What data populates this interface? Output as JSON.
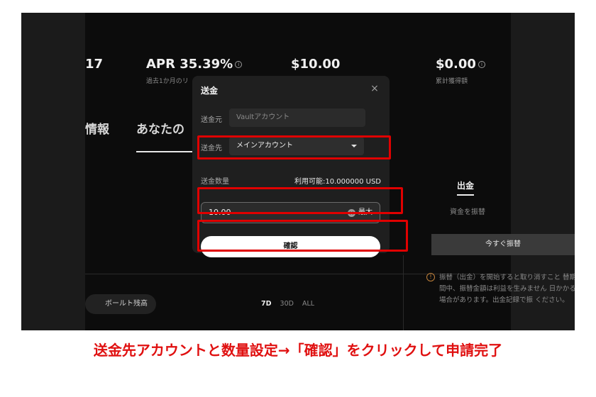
{
  "stats": [
    {
      "value": "17",
      "label": ""
    },
    {
      "value": "APR 35.39%",
      "label": "過去1か月のリ",
      "info": "i"
    },
    {
      "value": "$10.00",
      "label": ""
    },
    {
      "value": "$0.00",
      "label": "累計獲得額",
      "info": "i"
    }
  ],
  "tabs": {
    "info_partial": "情報",
    "yours_partial": "あなたの"
  },
  "right_panel": {
    "withdraw_tab": "出金",
    "sub_text": "資金を振替",
    "transfer_now": "今すぐ振替",
    "warning": "振替（出金）を開始すると取り消すこと 替期間中、振替金額は利益を生みません 日かかる場合があります。出金記録で振 ください。"
  },
  "bottom": {
    "vault_balance": "ボールト残高",
    "periods": [
      "7D",
      "30D",
      "ALL"
    ],
    "active_period": "7D"
  },
  "modal": {
    "title": "送金",
    "close": "×",
    "from_label": "送金元",
    "from_value": "Vaultアカウント",
    "to_label": "送金先",
    "to_value": "メインアカウント",
    "amount_label": "送金数量",
    "available": "利用可能:10.000000 USD",
    "amount_value": "10.00",
    "clear": "×",
    "max": "最大",
    "confirm": "確認"
  },
  "caption": "送金先アカウントと数量設定→「確認」をクリックして申請完了",
  "colors": {
    "highlight": "#e00000",
    "caption": "#e01010",
    "background": "#0c0c0c"
  }
}
